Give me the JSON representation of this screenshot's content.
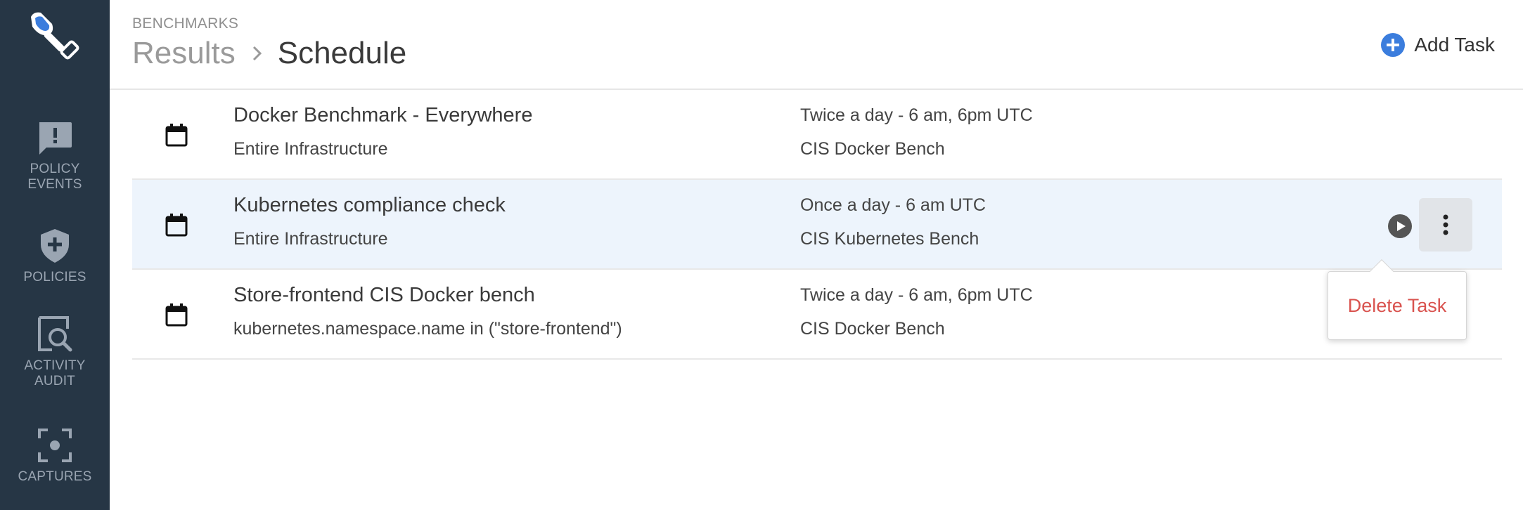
{
  "sidebar": {
    "items": [
      {
        "label": "Policy\nEvents",
        "icon": "chat-alert-icon"
      },
      {
        "label": "Policies",
        "icon": "shield-plus-icon"
      },
      {
        "label": "Activity\nAudit",
        "icon": "audit-search-icon"
      },
      {
        "label": "Captures",
        "icon": "capture-focus-icon"
      }
    ]
  },
  "header": {
    "section": "BENCHMARKS",
    "parent": "Results",
    "current": "Schedule",
    "add_task_label": "Add Task"
  },
  "tasks": [
    {
      "title": "Docker Benchmark - Everywhere",
      "scope": "Entire Infrastructure",
      "frequency": "Twice a day - 6 am, 6pm UTC",
      "benchmark": "CIS Docker Bench"
    },
    {
      "title": "Kubernetes compliance check",
      "scope": "Entire Infrastructure",
      "frequency": "Once a day - 6 am UTC",
      "benchmark": "CIS Kubernetes Bench"
    },
    {
      "title": "Store-frontend CIS Docker bench",
      "scope": "kubernetes.namespace.name in (\"store-frontend\")",
      "frequency": "Twice a day - 6 am, 6pm UTC",
      "benchmark": "CIS Docker Bench"
    }
  ],
  "menu": {
    "delete_label": "Delete Task"
  },
  "colors": {
    "sidebar": "#263645",
    "accent": "#3b7ddd",
    "danger": "#d9534f",
    "selected_row": "#edf4fc"
  }
}
